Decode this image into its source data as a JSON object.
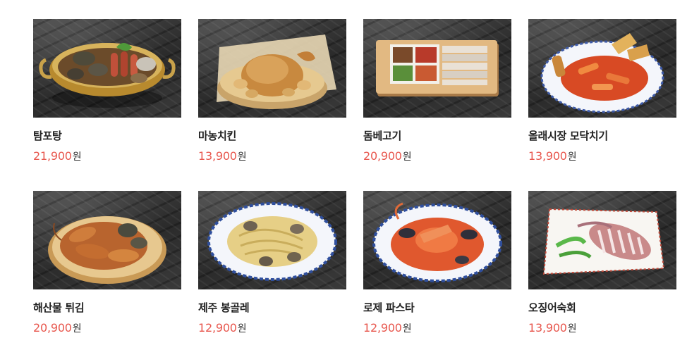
{
  "products": [
    {
      "name": "탐포탕",
      "price": "21,900",
      "currency": "원",
      "image_icon": "seafood-hotpot-image"
    },
    {
      "name": "마농치킨",
      "price": "13,900",
      "currency": "원",
      "image_icon": "garlic-chicken-image"
    },
    {
      "name": "돔베고기",
      "price": "20,900",
      "currency": "원",
      "image_icon": "sliced-pork-board-image"
    },
    {
      "name": "올래시장 모닥치기",
      "price": "13,900",
      "currency": "원",
      "image_icon": "tteokbokki-platter-image"
    },
    {
      "name": "해산물 튀김",
      "price": "20,900",
      "currency": "원",
      "image_icon": "fried-seafood-image"
    },
    {
      "name": "제주 봉골레",
      "price": "12,900",
      "currency": "원",
      "image_icon": "vongole-pasta-image"
    },
    {
      "name": "로제 파스타",
      "price": "12,900",
      "currency": "원",
      "image_icon": "rose-pasta-image"
    },
    {
      "name": "오징어숙회",
      "price": "13,900",
      "currency": "원",
      "image_icon": "boiled-squid-image"
    }
  ],
  "colors": {
    "price": "#e8584f",
    "name": "#222222",
    "currency": "#333333"
  }
}
